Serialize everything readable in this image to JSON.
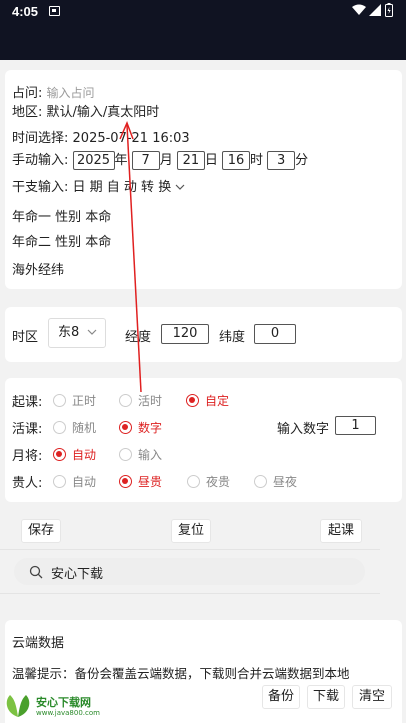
{
  "status": {
    "time": "4:05"
  },
  "form": {
    "zhanwen_label": "占问:",
    "zhanwen_placeholder": "输入占问",
    "diqu_label": "地区:",
    "diqu_value": "默认/输入/真太阳时",
    "time_label": "时间选择:",
    "time_value": "2025-07-21 16:03",
    "manual_label": "手动输入:",
    "year": "2025",
    "year_unit": "年",
    "month": "7",
    "month_unit": "月",
    "day": "21",
    "day_unit": "日",
    "hour": "16",
    "hour_unit": "时",
    "minute": "3",
    "minute_unit": "分",
    "ganzhi_label": "干支输入:",
    "ganzhi_value": "日 期 自 动 转 换",
    "ming1": "年命一 性别 本命",
    "ming2": "年命二 性别 本命",
    "overseas": "海外经纬"
  },
  "geo": {
    "tz_label": "时区",
    "tz_value": "东8",
    "lng_label": "经度",
    "lng_value": "120",
    "lat_label": "纬度",
    "lat_value": "0"
  },
  "options": {
    "qike_label": "起课:",
    "qike": [
      "正时",
      "活时",
      "自定"
    ],
    "huoke_label": "活课:",
    "huoke": [
      "随机",
      "数字"
    ],
    "input_num_label": "输入数字",
    "input_num_value": "1",
    "yuejiang_label": "月将:",
    "yuejiang": [
      "自动",
      "输入"
    ],
    "guiren_label": "贵人:",
    "guiren": [
      "自动",
      "昼贵",
      "夜贵",
      "昼夜"
    ]
  },
  "actions": {
    "save": "保存",
    "reset": "复位",
    "start": "起课"
  },
  "search": {
    "text": "安心下载"
  },
  "cloud": {
    "title": "云端数据",
    "tip": "温馨提示：备份会覆盖云端数据，下载则合并云端数据到本地",
    "backup": "备份",
    "download": "下载",
    "clear": "清空"
  },
  "watermark": {
    "name": "安心下载网",
    "url": "www.java800.com"
  },
  "colors": {
    "accent": "#dd2222",
    "statusbar": "#101322"
  }
}
